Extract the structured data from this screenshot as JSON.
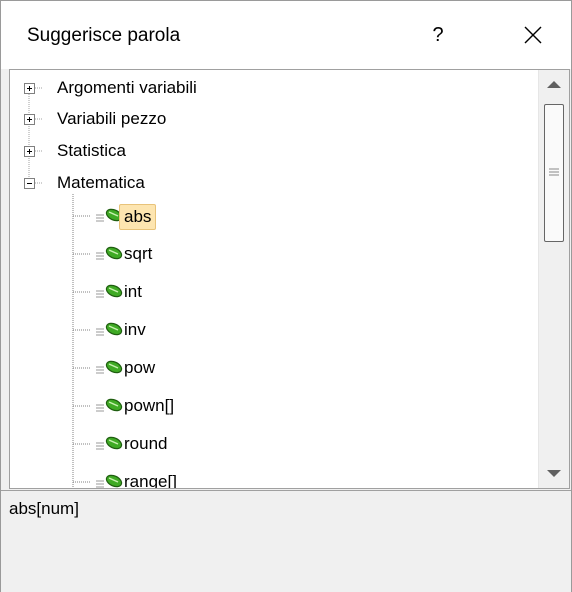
{
  "window": {
    "title": "Suggerisce parola",
    "help_label": "?",
    "close_icon": "close-icon"
  },
  "tree": {
    "categories": [
      {
        "label": "Argomenti variabili",
        "expanded": false
      },
      {
        "label": "Variabili pezzo",
        "expanded": false
      },
      {
        "label": "Statistica",
        "expanded": false
      },
      {
        "label": "Matematica",
        "expanded": true
      }
    ],
    "items": [
      {
        "label": "abs",
        "selected": true
      },
      {
        "label": "sqrt",
        "selected": false
      },
      {
        "label": "int",
        "selected": false
      },
      {
        "label": "inv",
        "selected": false
      },
      {
        "label": "pow",
        "selected": false
      },
      {
        "label": "pown[]",
        "selected": false
      },
      {
        "label": "round",
        "selected": false
      },
      {
        "label": "range[]",
        "selected": false
      }
    ],
    "item_icon": "function-icon",
    "selection_color": "#fde5b0"
  },
  "description": {
    "text": "abs[num]"
  }
}
